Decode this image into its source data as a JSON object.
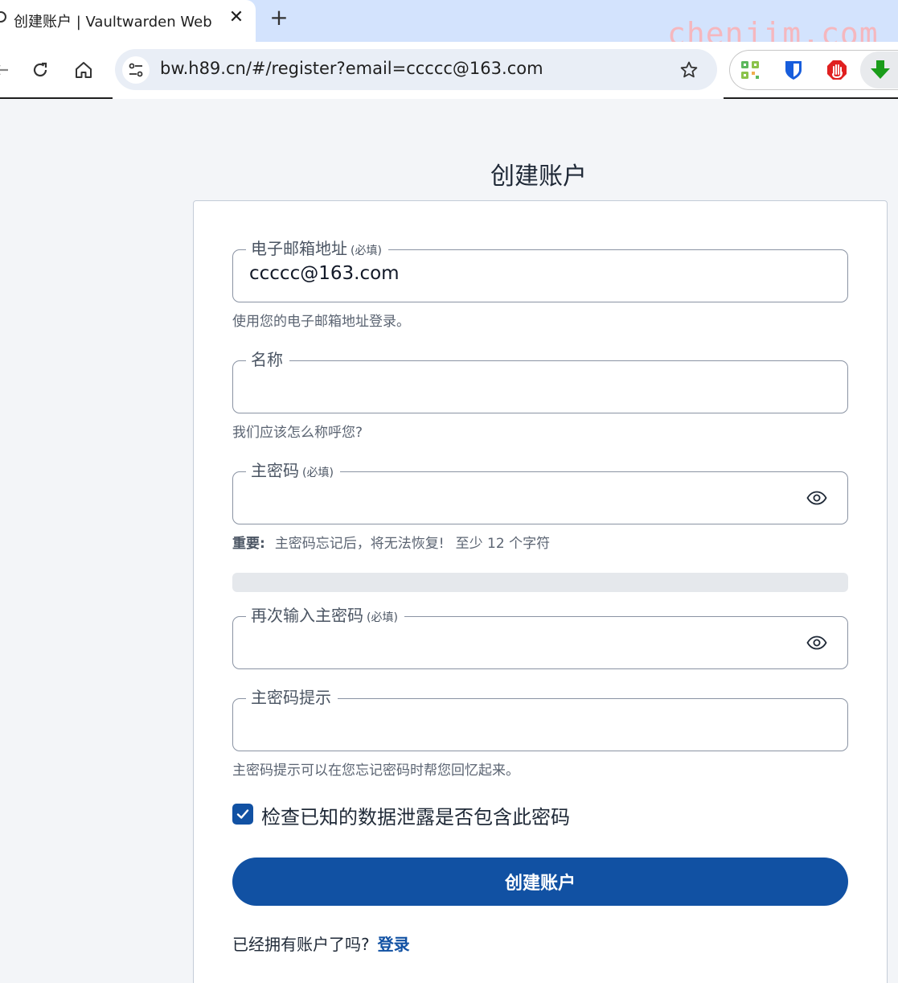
{
  "browser": {
    "tab_title": "创建账户 | Vaultwarden Web",
    "tab_close": "✕",
    "new_tab": "+",
    "url": "bw.h89.cn/#/register?email=ccccc@163.com",
    "watermark": "chenjim.com",
    "icons": [
      "back-arrow-icon",
      "reload-icon",
      "home-icon",
      "site-settings-icon",
      "bookmark-star-icon"
    ],
    "extensions": [
      "qr-code-extension-icon",
      "bitwarden-extension-icon",
      "adblock-extension-icon",
      "download-extension-icon"
    ]
  },
  "page": {
    "title": "创建账户"
  },
  "form": {
    "email": {
      "label": "电子邮箱地址",
      "required": "(必填)",
      "value": "ccccc@163.com",
      "hint": "使用您的电子邮箱地址登录。"
    },
    "name": {
      "label": "名称",
      "value": "",
      "hint": "我们应该怎么称呼您?"
    },
    "master_password": {
      "label": "主密码",
      "required": "(必填)",
      "value": "",
      "hint_strong": "重要:",
      "hint_text": "主密码忘记后，将无法恢复!",
      "hint_min": "至少 12 个字符",
      "strength": 0
    },
    "confirm_password": {
      "label": "再次输入主密码",
      "required": "(必填)",
      "value": ""
    },
    "password_hint": {
      "label": "主密码提示",
      "value": "",
      "hint": "主密码提示可以在您忘记密码时帮您回忆起来。"
    },
    "breach_check": {
      "label": "检查已知的数据泄露是否包含此密码",
      "checked": true
    },
    "submit_label": "创建账户",
    "login_prompt": "已经拥有账户了吗?",
    "login_link": "登录"
  },
  "colors": {
    "primary": "#1151a3",
    "page_bg": "#f3f5f8",
    "tabbar_bg": "#d3e3fd"
  }
}
